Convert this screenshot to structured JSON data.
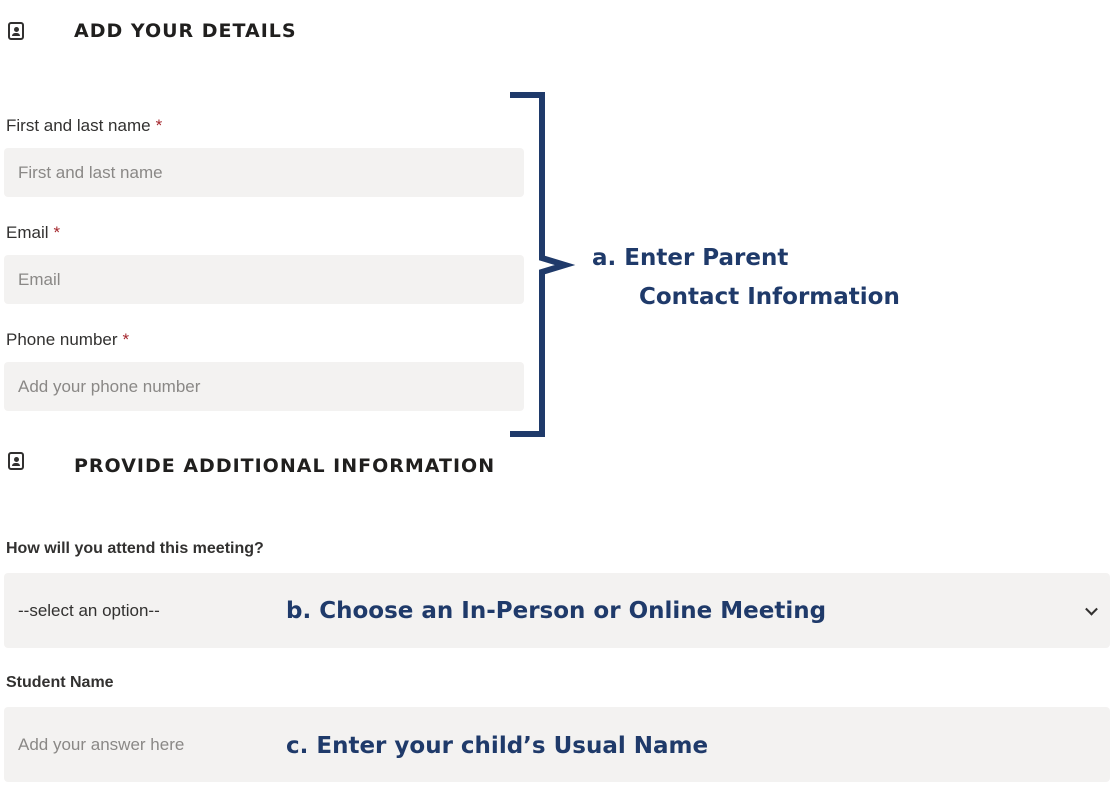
{
  "sections": {
    "details_title": "ADD YOUR DETAILS",
    "additional_title": "PROVIDE ADDITIONAL INFORMATION"
  },
  "fields": {
    "name": {
      "label": "First and last name",
      "required": "*",
      "placeholder": "First and last name"
    },
    "email": {
      "label": "Email",
      "required": "*",
      "placeholder": "Email"
    },
    "phone": {
      "label": "Phone number",
      "required": "*",
      "placeholder": "Add your phone number"
    },
    "attend": {
      "label": "How will you attend this meeting?",
      "selected": "--select an option--"
    },
    "student": {
      "label": "Student Name",
      "placeholder": "Add your answer here"
    }
  },
  "annotations": {
    "a_line1": "a. Enter Parent",
    "a_line2": "Contact Information",
    "b": "b. Choose an In-Person or Online Meeting",
    "c": "c. Enter your child’s Usual Name"
  },
  "icons": [
    "contact-card-icon",
    "contact-card-icon",
    "chevron-down-icon"
  ],
  "colors": {
    "annotation": "#1f3a6a",
    "required": "#a4262c",
    "field_bg": "#f3f2f1"
  }
}
